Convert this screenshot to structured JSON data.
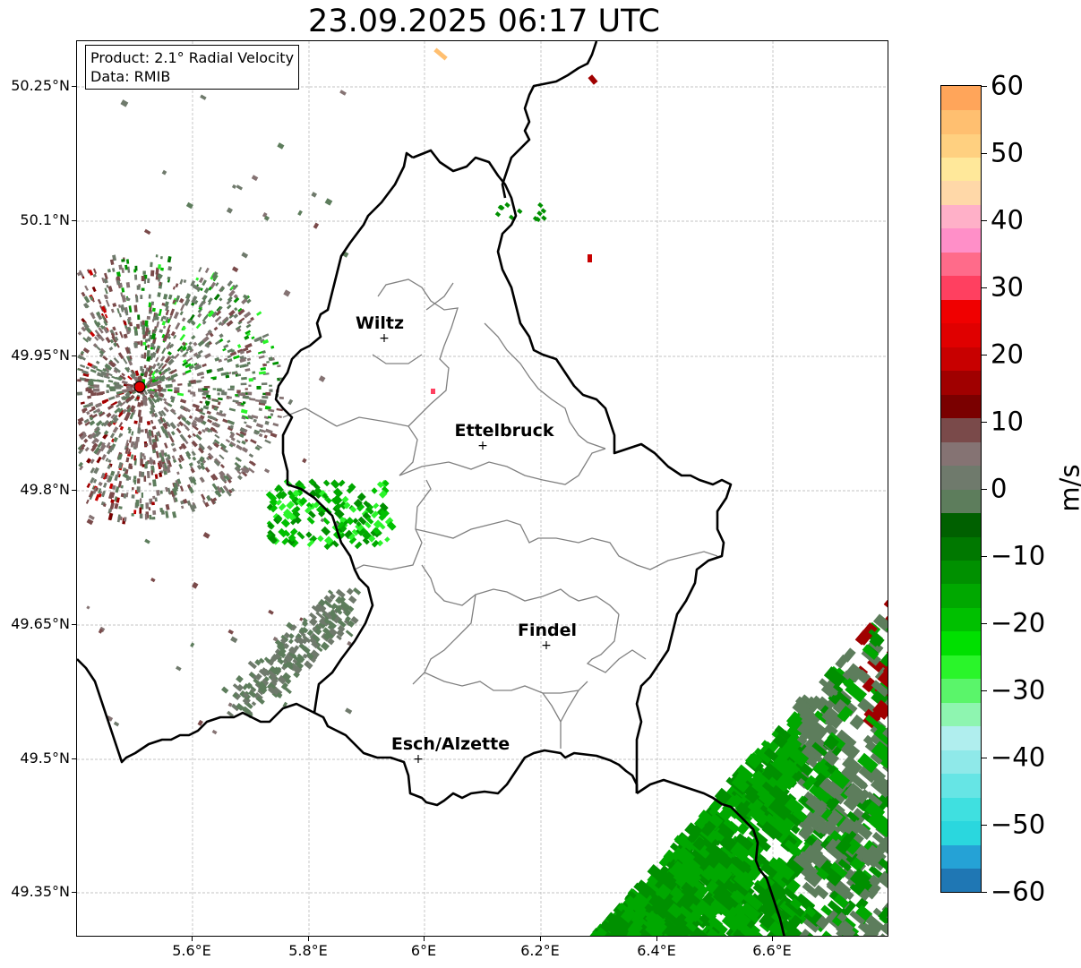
{
  "title": "23.09.2025 06:17 UTC",
  "info": {
    "product": "Product: 2.1° Radial Velocity",
    "data": "Data: RMIB"
  },
  "lat_labels": [
    "50.25°N",
    "50.1°N",
    "49.95°N",
    "49.8°N",
    "49.65°N",
    "49.5°N",
    "49.35°N"
  ],
  "lon_labels": [
    "5.6°E",
    "5.8°E",
    "6°E",
    "6.2°E",
    "6.4°E",
    "6.6°E"
  ],
  "colorbar": {
    "unit": "m/s",
    "ticks": [
      "60",
      "50",
      "40",
      "30",
      "20",
      "10",
      "0",
      "−10",
      "−20",
      "−30",
      "−40",
      "−50",
      "−60"
    ],
    "min": -60,
    "max": 60,
    "colors": [
      "#1f77b4",
      "#25a2d6",
      "#2ad7de",
      "#3fe0e0",
      "#66e5e5",
      "#8fe9e9",
      "#b0eeee",
      "#8ef5b0",
      "#5af56a",
      "#2af52a",
      "#00e000",
      "#00c000",
      "#00a800",
      "#009000",
      "#007800",
      "#006000",
      "#5d7d5c",
      "#6f7a6c",
      "#857373",
      "#7a4a4a",
      "#7a0000",
      "#a00000",
      "#c80000",
      "#e00000",
      "#f00000",
      "#ff4060",
      "#ff6b8a",
      "#ff8fc8",
      "#ffb0c8",
      "#ffd8a8",
      "#ffe89a",
      "#ffd080",
      "#ffbf70",
      "#ffa55a"
    ]
  },
  "cities": [
    {
      "name": "Wiltz"
    },
    {
      "name": "Ettelbruck"
    },
    {
      "name": "Findel"
    },
    {
      "name": "Esch/Alzette"
    }
  ],
  "radar_site_color": "#e00000",
  "border_color": "#000000",
  "district_color": "#808080"
}
